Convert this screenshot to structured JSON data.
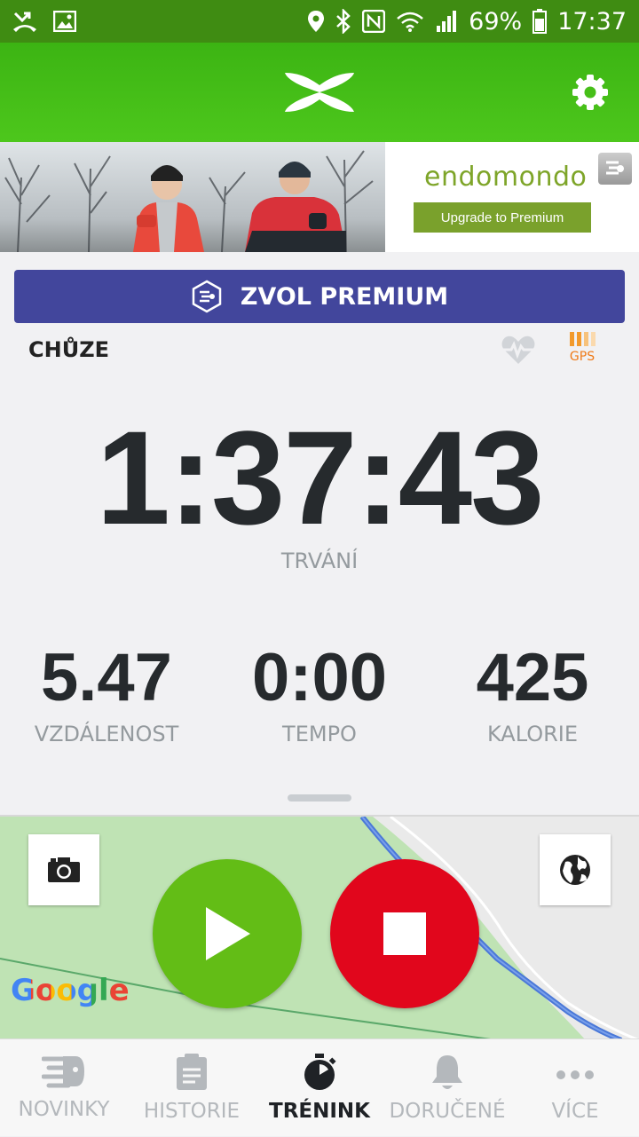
{
  "status_bar": {
    "battery": "69%",
    "time": "17:37"
  },
  "banner": {
    "brand": "endomondo",
    "upgrade_label": "Upgrade to Premium"
  },
  "premium_button": {
    "label": "ZVOL PREMIUM"
  },
  "workout": {
    "sport": "CHŮZE",
    "gps_label": "GPS",
    "duration": "1:37:43",
    "duration_label": "TRVÁNÍ",
    "stats": [
      {
        "value": "5.47",
        "label": "VZDÁLENOST"
      },
      {
        "value": "0:00",
        "label": "TEMPO"
      },
      {
        "value": "425",
        "label": "KALORIE"
      }
    ]
  },
  "map": {
    "attribution": "Google"
  },
  "colors": {
    "accent_green": "#4dc71c",
    "premium_purple": "#42469c",
    "play_green": "#63bd16",
    "stop_red": "#e1061c",
    "gps_orange": "#f29a2c"
  },
  "nav": {
    "items": [
      {
        "label": "NOVINKY",
        "icon": "feed-icon"
      },
      {
        "label": "HISTORIE",
        "icon": "history-icon"
      },
      {
        "label": "TRÉNINK",
        "icon": "stopwatch-icon",
        "active": true
      },
      {
        "label": "DORUČENÉ",
        "icon": "bell-icon"
      },
      {
        "label": "VÍCE",
        "icon": "more-icon"
      }
    ]
  }
}
